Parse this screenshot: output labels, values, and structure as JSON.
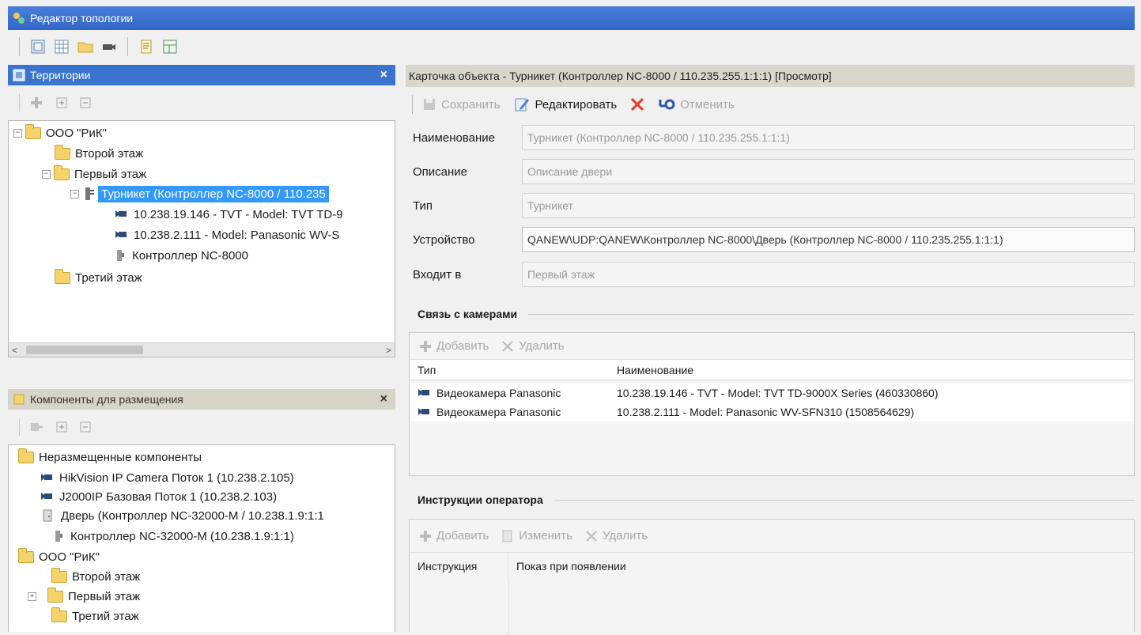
{
  "window": {
    "title": "Редактор топологии"
  },
  "territories": {
    "title": "Территории",
    "close": "×",
    "tree": [
      {
        "label": "ООО \"РиК\"",
        "expander": "−"
      },
      {
        "label": "Второй этаж"
      },
      {
        "label": "Первый этаж",
        "expander": "−"
      },
      {
        "label": "Турникет (Контроллер NC-8000 / 110.235",
        "expander": "−"
      },
      {
        "label": "10.238.19.146 - TVT - Model: TVT TD-9"
      },
      {
        "label": "10.238.2.111 - Model: Panasonic WV-S"
      },
      {
        "label": "Контроллер NC-8000"
      },
      {
        "label": "Третий этаж"
      }
    ],
    "scroll_left": "<",
    "scroll_right": ">"
  },
  "components": {
    "title": "Компоненты для размещения",
    "close": "×",
    "tree": [
      {
        "label": "Неразмещенные компоненты"
      },
      {
        "label": "HikVision IP Camera Поток 1 (10.238.2.105)"
      },
      {
        "label": "J2000IP Базовая Поток 1 (10.238.2.103)"
      },
      {
        "label": "Дверь (Контроллер NC-32000-M / 10.238.1.9:1:1"
      },
      {
        "label": "Контроллер NC-32000-M (10.238.1.9:1:1)"
      },
      {
        "label": "ООО \"РиК\""
      },
      {
        "label": "Второй этаж"
      },
      {
        "label": "Первый этаж",
        "expander": "+"
      },
      {
        "label": "Третий этаж"
      }
    ]
  },
  "card": {
    "title": "Карточка объекта - Турникет (Контроллер NC-8000 / 110.235.255.1:1:1) [Просмотр]",
    "toolbar": {
      "save": "Сохранить",
      "edit": "Редактировать",
      "cancel": "Отменить"
    },
    "fields": [
      {
        "label": "Наименование",
        "value": "Турникет (Контроллер NC-8000 / 110.235.255.1:1:1)"
      },
      {
        "label": "Описание",
        "value": "Описание двери"
      },
      {
        "label": "Тип",
        "value": "Турникет"
      },
      {
        "label": "Устройство",
        "value": "QANEW\\UDP:QANEW\\Контроллер NC-8000\\Дверь (Контроллер NC-8000 / 110.235.255.1:1:1)"
      },
      {
        "label": "Входит в",
        "value": "Первый этаж"
      }
    ],
    "cameras": {
      "title": "Связь с камерами",
      "add": "Добавить",
      "delete": "Удалить",
      "columns": [
        "Тип",
        "Наименование"
      ],
      "rows": [
        {
          "type": "Видеокамера Panasonic",
          "name": "10.238.19.146 - TVT - Model: TVT TD-9000X Series (460330860)"
        },
        {
          "type": "Видеокамера Panasonic",
          "name": "10.238.2.111 - Model: Panasonic WV-SFN310 (1508564629)"
        }
      ]
    },
    "instructions": {
      "title": "Инструкции оператора",
      "add": "Добавить",
      "edit": "Изменить",
      "delete": "Удалить",
      "columns": [
        "Инструкция",
        "Показ при появлении"
      ]
    }
  },
  "colors": {
    "titlebar": "#3166c8",
    "selection": "#3399ff",
    "active_header": "#3a74cf",
    "inactive_header": "#d7d4c8"
  }
}
